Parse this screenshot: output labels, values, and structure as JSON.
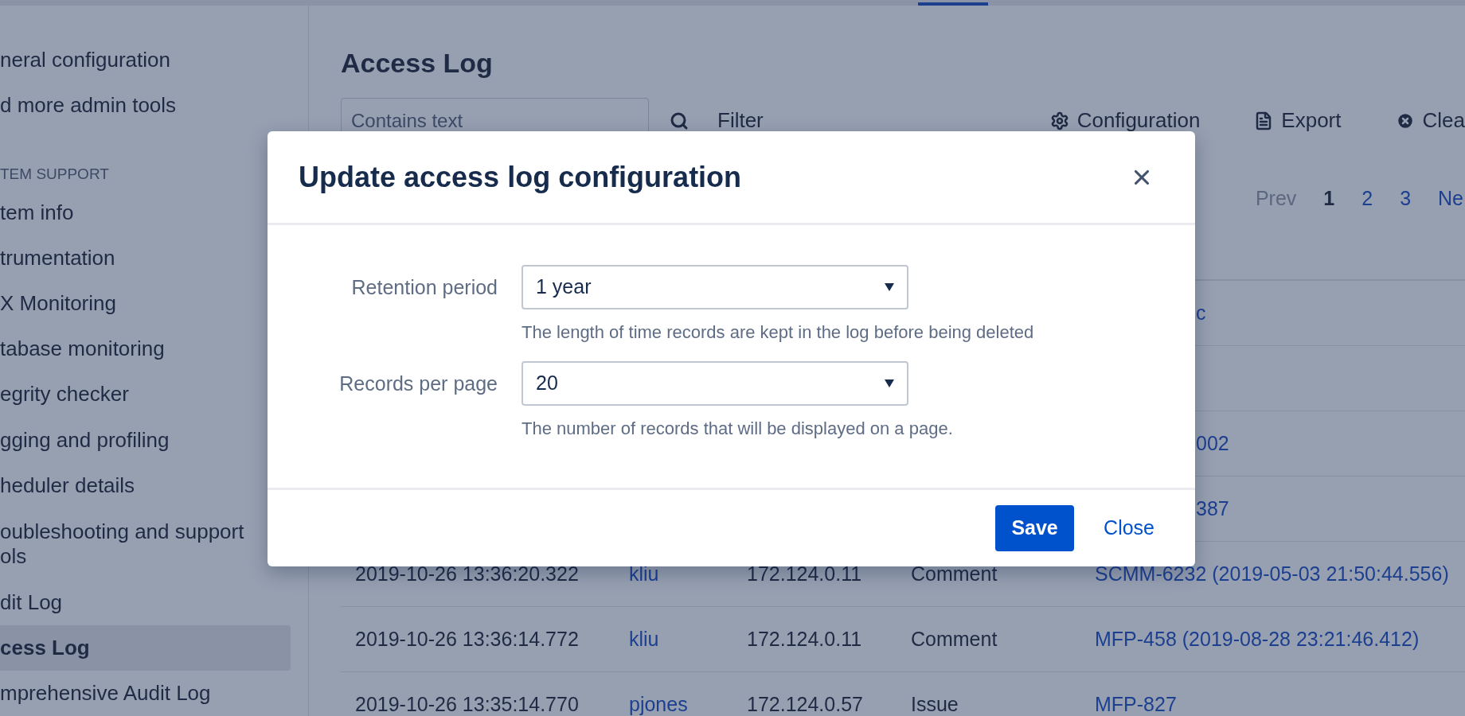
{
  "sidebar": {
    "items": [
      {
        "lines": [
          "neral configuration"
        ],
        "selected": false,
        "kind": "item"
      },
      {
        "lines": [
          "d more admin tools"
        ],
        "selected": false,
        "kind": "item"
      },
      {
        "lines": [
          "TEM SUPPORT"
        ],
        "selected": false,
        "kind": "heading"
      },
      {
        "lines": [
          "tem info"
        ],
        "selected": false,
        "kind": "item"
      },
      {
        "lines": [
          "trumentation"
        ],
        "selected": false,
        "kind": "item"
      },
      {
        "lines": [
          "X Monitoring"
        ],
        "selected": false,
        "kind": "item"
      },
      {
        "lines": [
          "tabase monitoring"
        ],
        "selected": false,
        "kind": "item"
      },
      {
        "lines": [
          "egrity checker"
        ],
        "selected": false,
        "kind": "item"
      },
      {
        "lines": [
          "gging and profiling"
        ],
        "selected": false,
        "kind": "item"
      },
      {
        "lines": [
          "heduler details"
        ],
        "selected": false,
        "kind": "item"
      },
      {
        "lines": [
          "oubleshooting and support",
          "ols"
        ],
        "selected": false,
        "kind": "item"
      },
      {
        "lines": [
          "dit Log"
        ],
        "selected": false,
        "kind": "item"
      },
      {
        "lines": [
          "cess Log"
        ],
        "selected": true,
        "kind": "item"
      },
      {
        "lines": [
          "mprehensive Audit Log"
        ],
        "selected": false,
        "kind": "item"
      }
    ]
  },
  "page": {
    "title": "Access Log",
    "search": {
      "placeholder": "Contains text"
    },
    "filter": "Filter",
    "actions": [
      {
        "kind": "gear",
        "label": "Configuration"
      },
      {
        "kind": "document",
        "label": "Export"
      },
      {
        "kind": "clear",
        "label": "Clea"
      }
    ],
    "pagination": [
      {
        "label": "Prev",
        "kind": "disabled",
        "selected": false
      },
      {
        "label": "1",
        "kind": "page",
        "selected": true
      },
      {
        "label": "2",
        "kind": "page",
        "selected": false
      },
      {
        "label": "3",
        "kind": "page",
        "selected": false
      },
      {
        "label": "Ne",
        "kind": "next",
        "selected": false
      }
    ],
    "rows": [
      {
        "kind": "partial",
        "object": "c"
      },
      {
        "kind": "partial",
        "object": ""
      },
      {
        "kind": "partial",
        "object": "002"
      },
      {
        "kind": "partial",
        "object": "387"
      },
      {
        "kind": "full",
        "time": "2019-10-26 13:36:20.322",
        "user": "kliu",
        "ip": "172.124.0.11",
        "type": "Comment",
        "object": "SCMM-6232 (2019-05-03 21:50:44.556)"
      },
      {
        "kind": "full",
        "time": "2019-10-26 13:36:14.772",
        "user": "kliu",
        "ip": "172.124.0.11",
        "type": "Comment",
        "object": "MFP-458 (2019-08-28 23:21:46.412)"
      },
      {
        "kind": "full",
        "time": "2019-10-26 13:35:14.770",
        "user": "pjones",
        "ip": "172.124.0.57",
        "type": "Issue",
        "object": "MFP-827"
      }
    ]
  },
  "dialog": {
    "title": "Update access log configuration",
    "fields": [
      {
        "label": "Retention period",
        "value": "1 year",
        "help": "The length of time records are kept in the log before being deleted"
      },
      {
        "label": "Records per page",
        "value": "20",
        "help": "The number of records that will be displayed on a page."
      }
    ],
    "save": "Save",
    "close": "Close"
  }
}
